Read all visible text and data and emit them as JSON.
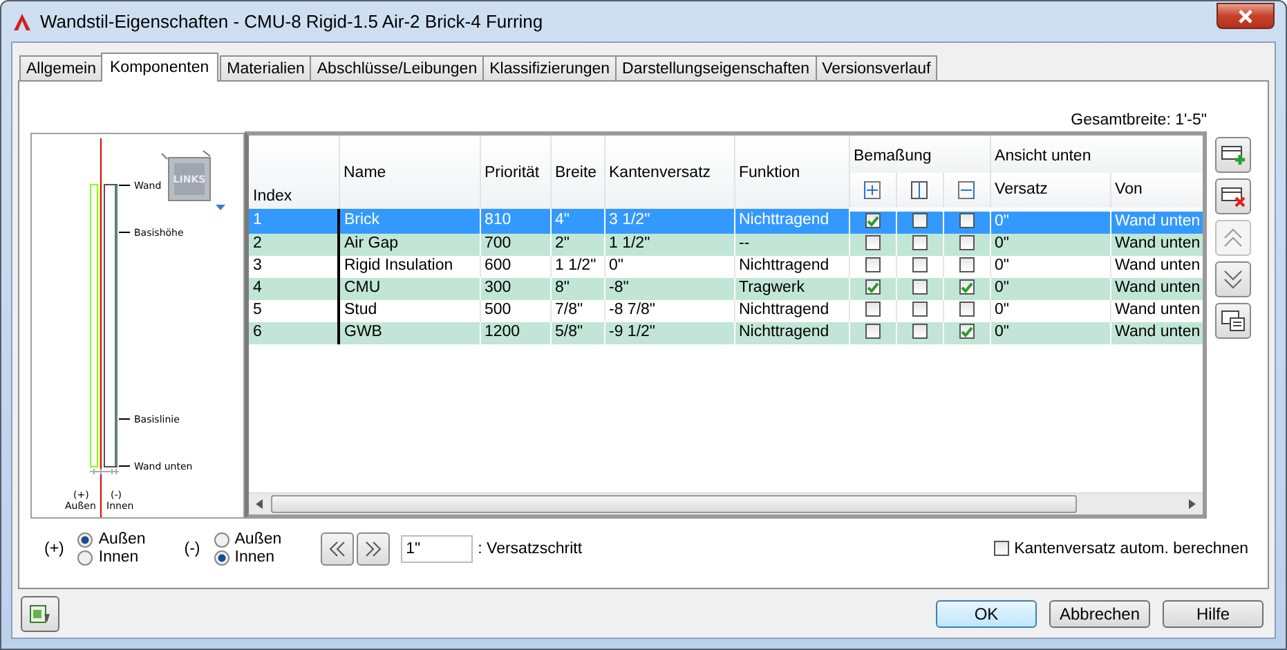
{
  "window": {
    "title": "Wandstil-Eigenschaften - CMU-8 Rigid-1.5 Air-2 Brick-4 Furring"
  },
  "tabs": [
    {
      "label": "Allgemein",
      "selected": false
    },
    {
      "label": "Komponenten",
      "selected": true
    },
    {
      "label": "Materialien",
      "selected": false
    },
    {
      "label": "Abschlüsse/Leibungen",
      "selected": false
    },
    {
      "label": "Klassifizierungen",
      "selected": false
    },
    {
      "label": "Darstellungseigenschaften",
      "selected": false
    },
    {
      "label": "Versionsverlauf",
      "selected": false
    }
  ],
  "total_width": "Gesamtbreite: 1'-5\"",
  "preview": {
    "view_cube": "LINKS",
    "labels": [
      "Wand",
      "Basishöhe",
      "Basislinie",
      "Wand unten"
    ],
    "plus_sign": "(+)",
    "plus_label": "Außen",
    "minus_sign": "(-)",
    "minus_label": "Innen"
  },
  "table": {
    "columns": [
      "Index",
      "Name",
      "Priorität",
      "Breite",
      "Kantenversatz",
      "Funktion"
    ],
    "dimension_group": "Bemaßung",
    "dimension_columns": [
      {
        "kind": "outer"
      },
      {
        "kind": "center"
      },
      {
        "kind": "inner"
      }
    ],
    "view_group": "Ansicht unten",
    "view_columns": [
      "Versatz",
      "Von"
    ],
    "rows": [
      {
        "selected": true,
        "cells": [
          "1",
          "Brick",
          "810",
          "4\"",
          "3 1/2\"",
          "Nichttragend"
        ],
        "dims": [
          true,
          false,
          false
        ],
        "view": [
          "0\"",
          "Wand unten"
        ]
      },
      {
        "selected": false,
        "cells": [
          "2",
          "Air Gap",
          "700",
          "2\"",
          "1 1/2\"",
          "--"
        ],
        "dims": [
          false,
          false,
          false
        ],
        "view": [
          "0\"",
          "Wand unten"
        ]
      },
      {
        "selected": false,
        "cells": [
          "3",
          "Rigid Insulation",
          "600",
          "1 1/2\"",
          "0\"",
          "Nichttragend"
        ],
        "dims": [
          false,
          false,
          false
        ],
        "view": [
          "0\"",
          "Wand unten"
        ]
      },
      {
        "selected": false,
        "cells": [
          "4",
          "CMU",
          "300",
          "8\"",
          "-8\"",
          "Tragwerk"
        ],
        "dims": [
          true,
          false,
          true
        ],
        "view": [
          "0\"",
          "Wand unten"
        ]
      },
      {
        "selected": false,
        "cells": [
          "5",
          "Stud",
          "500",
          "7/8\"",
          "-8 7/8\"",
          "Nichttragend"
        ],
        "dims": [
          false,
          false,
          false
        ],
        "view": [
          "0\"",
          "Wand unten"
        ]
      },
      {
        "selected": false,
        "cells": [
          "6",
          "GWB",
          "1200",
          "5/8\"",
          "-9 1/2\"",
          "Nichttragend"
        ],
        "dims": [
          false,
          false,
          true
        ],
        "view": [
          "0\"",
          "Wand unten"
        ]
      }
    ]
  },
  "side_buttons": [
    {
      "kind": "add",
      "disabled": false
    },
    {
      "kind": "delete",
      "disabled": false
    },
    {
      "kind": "up",
      "disabled": true
    },
    {
      "kind": "down",
      "disabled": false
    },
    {
      "kind": "list",
      "disabled": false
    }
  ],
  "positive_side": {
    "label": "(+)",
    "options": [
      {
        "label": "Außen",
        "selected": true
      },
      {
        "label": "Innen",
        "selected": false
      }
    ]
  },
  "negative_side": {
    "label": "(-)",
    "options": [
      {
        "label": "Außen",
        "selected": false
      },
      {
        "label": "Innen",
        "selected": true
      }
    ]
  },
  "offset_step": {
    "value": "1\"",
    "label": ": Versatzschritt"
  },
  "auto_offset": {
    "label": "Kantenversatz autom. berechnen",
    "checked": false
  },
  "buttons": [
    {
      "label": "OK",
      "default": true
    },
    {
      "label": "Abbrechen",
      "default": false
    },
    {
      "label": "Hilfe",
      "default": false
    }
  ]
}
